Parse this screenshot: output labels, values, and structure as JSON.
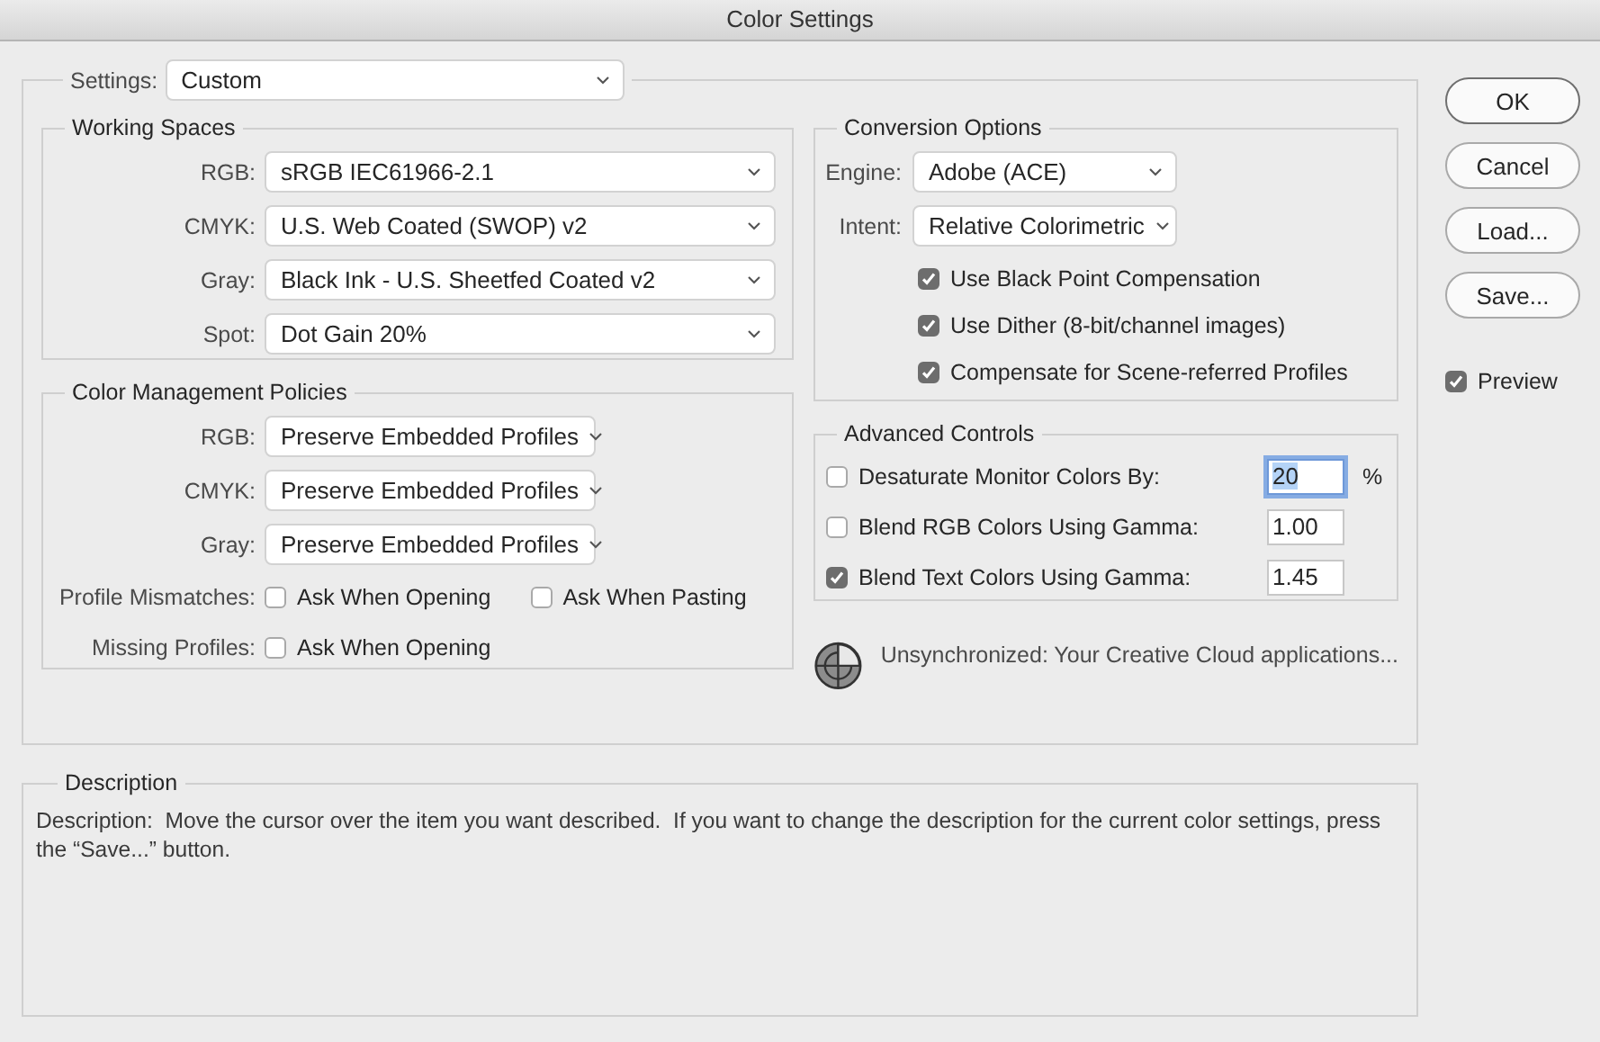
{
  "window": {
    "title": "Color Settings"
  },
  "settings": {
    "label": "Settings:",
    "value": "Custom"
  },
  "working_spaces": {
    "title": "Working Spaces",
    "rows": [
      {
        "label": "RGB:",
        "value": "sRGB IEC61966-2.1"
      },
      {
        "label": "CMYK:",
        "value": "U.S. Web Coated (SWOP) v2"
      },
      {
        "label": "Gray:",
        "value": "Black Ink - U.S. Sheetfed Coated v2"
      },
      {
        "label": "Spot:",
        "value": "Dot Gain 20%"
      }
    ]
  },
  "policies": {
    "title": "Color Management Policies",
    "rows": [
      {
        "label": "RGB:",
        "value": "Preserve Embedded Profiles"
      },
      {
        "label": "CMYK:",
        "value": "Preserve Embedded Profiles"
      },
      {
        "label": "Gray:",
        "value": "Preserve Embedded Profiles"
      }
    ],
    "checks": [
      {
        "label": "Profile Mismatches:",
        "options": [
          {
            "label": "Ask When Opening",
            "checked": false
          },
          {
            "label": "Ask When Pasting",
            "checked": false
          }
        ]
      },
      {
        "label": "Missing Profiles:",
        "options": [
          {
            "label": "Ask When Opening",
            "checked": false
          }
        ]
      }
    ]
  },
  "conversion": {
    "title": "Conversion Options",
    "selects": [
      {
        "label": "Engine:",
        "value": "Adobe (ACE)"
      },
      {
        "label": "Intent:",
        "value": "Relative Colorimetric"
      }
    ],
    "options": [
      {
        "label": "Use Black Point Compensation",
        "checked": true
      },
      {
        "label": "Use Dither (8-bit/channel images)",
        "checked": true
      },
      {
        "label": "Compensate for Scene-referred Profiles",
        "checked": true
      }
    ]
  },
  "advanced": {
    "title": "Advanced Controls",
    "rows": [
      {
        "label": "Desaturate Monitor Colors By:",
        "checked": false,
        "value": "20",
        "focused": true,
        "unit": "%"
      },
      {
        "label": "Blend RGB Colors Using Gamma:",
        "checked": false,
        "value": "1.00",
        "focused": false
      },
      {
        "label": "Blend Text Colors Using Gamma:",
        "checked": true,
        "value": "1.45",
        "focused": false
      }
    ]
  },
  "sync_status": "Unsynchronized: Your Creative Cloud applications...",
  "description": {
    "title": "Description",
    "text": "Description:  Move the cursor over the item you want described.  If you want to change the description for the current color settings, press the “Save...” button."
  },
  "buttons": [
    {
      "label": "OK",
      "default": true
    },
    {
      "label": "Cancel",
      "default": false
    },
    {
      "label": "Load...",
      "default": false
    },
    {
      "label": "Save...",
      "default": false
    }
  ],
  "preview": {
    "label": "Preview",
    "checked": true
  }
}
